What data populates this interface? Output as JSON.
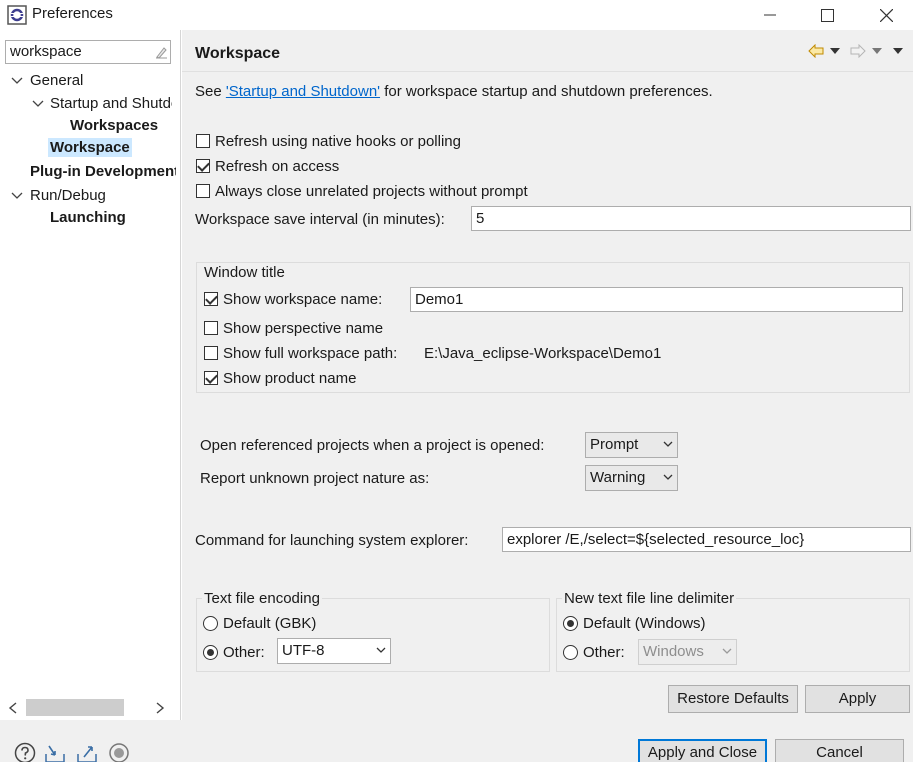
{
  "window": {
    "title": "Preferences"
  },
  "filter": {
    "value": "workspace"
  },
  "tree": {
    "items": [
      {
        "label": "General"
      },
      {
        "label": "Startup and Shutdown"
      },
      {
        "label": "Workspaces"
      },
      {
        "label": "Workspace"
      },
      {
        "label": "Plug-in Development"
      },
      {
        "label": "Run/Debug"
      },
      {
        "label": "Launching"
      }
    ]
  },
  "page": {
    "title": "Workspace",
    "intro_prefix": "See ",
    "intro_link": "'Startup and Shutdown'",
    "intro_suffix": " for workspace startup and shutdown preferences.",
    "refresh_native_label": "Refresh using native hooks or polling",
    "refresh_access_label": "Refresh on access",
    "always_close_label": "Always close unrelated projects without prompt",
    "save_interval_label": "Workspace save interval (in minutes):",
    "save_interval_value": "5",
    "window_title_group": "Window title",
    "show_ws_name_label": "Show workspace name:",
    "show_ws_name_value": "Demo1",
    "show_perspective_label": "Show perspective name",
    "show_full_path_label": "Show full workspace path:",
    "full_path_value": "E:\\Java_eclipse-Workspace\\Demo1",
    "show_product_label": "Show product name",
    "open_ref_label": "Open referenced projects when a project is opened:",
    "open_ref_value": "Prompt",
    "unknown_nature_label": "Report unknown project nature as:",
    "unknown_nature_value": "Warning",
    "explorer_label": "Command for launching system explorer:",
    "explorer_value": "explorer /E,/select=${selected_resource_loc}",
    "encoding_group": "Text file encoding",
    "encoding_default_label": "Default (GBK)",
    "encoding_other_label": "Other:",
    "encoding_other_value": "UTF-8",
    "delimiter_group": "New text file line delimiter",
    "delimiter_default_label": "Default (Windows)",
    "delimiter_other_label": "Other:",
    "delimiter_other_value": "Windows",
    "restore_defaults": "Restore Defaults",
    "apply": "Apply"
  },
  "footer": {
    "apply_close": "Apply and Close",
    "cancel": "Cancel"
  }
}
